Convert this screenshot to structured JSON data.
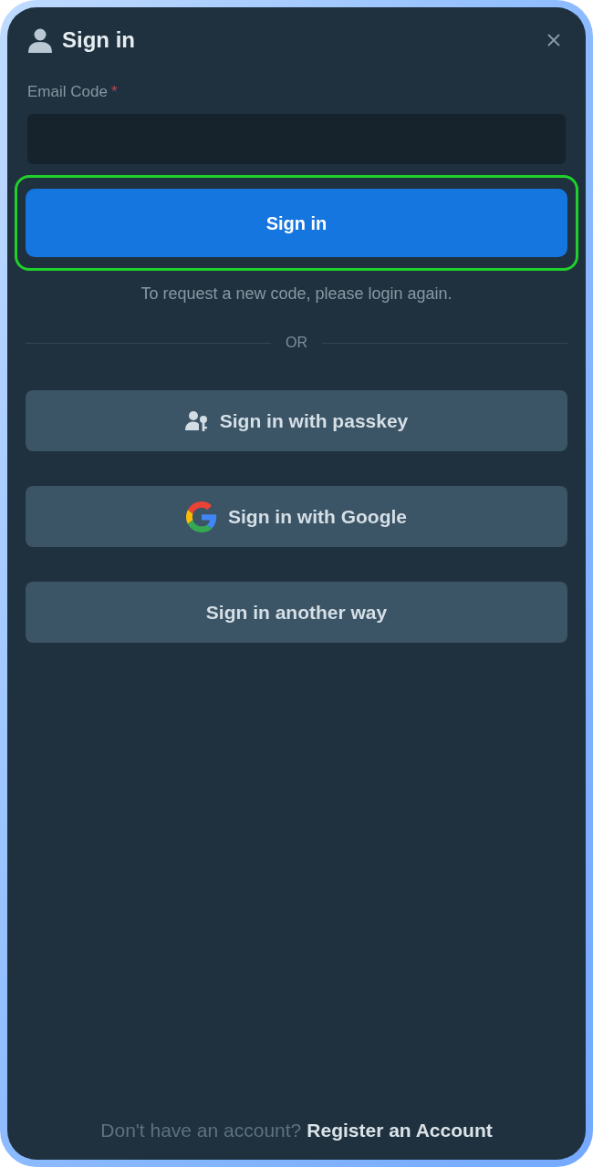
{
  "dialog": {
    "title": "Sign in"
  },
  "field": {
    "label": "Email Code",
    "required_mark": "*"
  },
  "primary_button": {
    "label": "Sign in",
    "highlighted": true
  },
  "hint": "To request a new code, please login again.",
  "divider": {
    "label": "OR"
  },
  "alt_buttons": [
    {
      "kind": "passkey",
      "label": "Sign in with passkey"
    },
    {
      "kind": "google",
      "label": "Sign in with Google"
    },
    {
      "kind": "plain",
      "label": "Sign in another way"
    }
  ],
  "footer": {
    "prompt": "Don't have an account?",
    "link": "Register an Account"
  }
}
